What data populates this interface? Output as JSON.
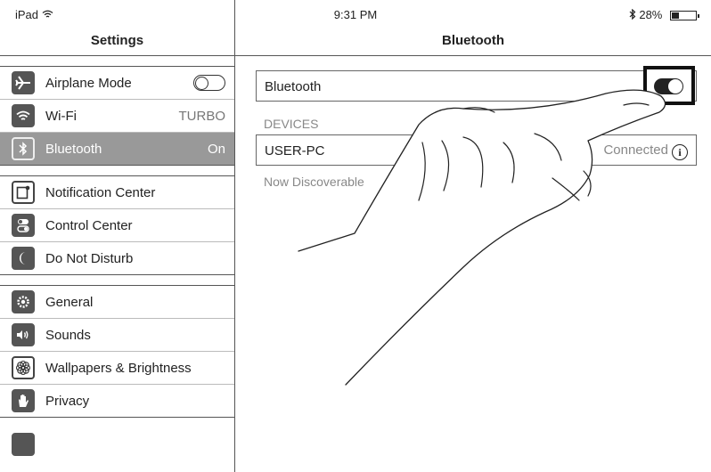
{
  "status_bar": {
    "device": "iPad",
    "wifi_icon": "wifi-icon",
    "time": "9:31 PM",
    "bluetooth_icon": "bluetooth-icon",
    "battery_text": "28%",
    "battery_level": 0.28
  },
  "sidebar": {
    "title": "Settings",
    "groups": [
      [
        {
          "label": "Airplane Mode",
          "icon": "airplane-icon",
          "control": "toggle-off"
        },
        {
          "label": "Wi-Fi",
          "icon": "wifi-icon",
          "value": "TURBO"
        },
        {
          "label": "Bluetooth",
          "icon": "bluetooth-icon",
          "value": "On",
          "selected": true
        }
      ],
      [
        {
          "label": "Notification Center",
          "icon": "notification-center-icon"
        },
        {
          "label": "Control Center",
          "icon": "control-center-icon"
        },
        {
          "label": "Do Not Disturb",
          "icon": "moon-icon"
        }
      ],
      [
        {
          "label": "General",
          "icon": "gear-icon"
        },
        {
          "label": "Sounds",
          "icon": "speaker-icon"
        },
        {
          "label": "Wallpapers & Brightness",
          "icon": "flower-icon"
        },
        {
          "label": "Privacy",
          "icon": "hand-icon"
        }
      ]
    ]
  },
  "main": {
    "title": "Bluetooth",
    "bluetooth_label": "Bluetooth",
    "bluetooth_on": true,
    "devices_header": "DEVICES",
    "devices": [
      {
        "name": "USER-PC",
        "status": "Connected",
        "info_icon": "info-icon"
      }
    ],
    "footer": "Now Discoverable"
  }
}
